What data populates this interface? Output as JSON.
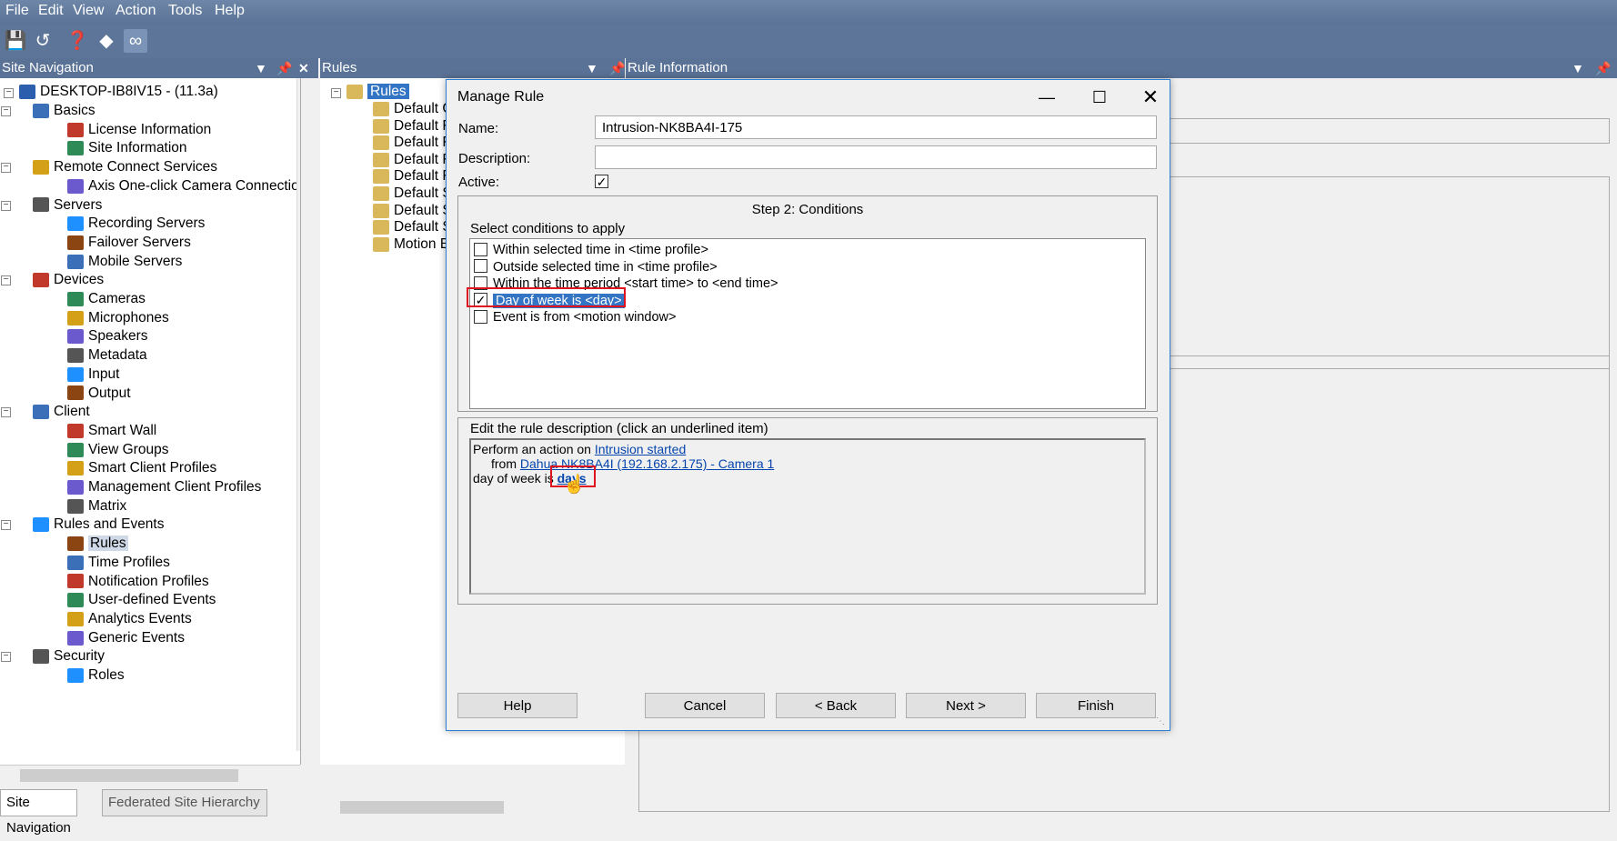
{
  "menu": [
    "File",
    "Edit",
    "View",
    "Action",
    "Tools",
    "Help"
  ],
  "toolbar": {
    "icons": [
      "save-icon",
      "undo-icon",
      "help-icon",
      "wizard-icon",
      "binoculars-icon"
    ]
  },
  "site_nav": {
    "header": "Site Navigation",
    "root": "DESKTOP-IB8IV15 - (11.3a)",
    "nodes": [
      {
        "label": "Basics",
        "level": 1
      },
      {
        "label": "License Information",
        "level": 2
      },
      {
        "label": "Site Information",
        "level": 2
      },
      {
        "label": "Remote Connect Services",
        "level": 1
      },
      {
        "label": "Axis One-click Camera Connectio",
        "level": 2
      },
      {
        "label": "Servers",
        "level": 1
      },
      {
        "label": "Recording Servers",
        "level": 2
      },
      {
        "label": "Failover Servers",
        "level": 2
      },
      {
        "label": "Mobile Servers",
        "level": 2
      },
      {
        "label": "Devices",
        "level": 1
      },
      {
        "label": "Cameras",
        "level": 2
      },
      {
        "label": "Microphones",
        "level": 2
      },
      {
        "label": "Speakers",
        "level": 2
      },
      {
        "label": "Metadata",
        "level": 2
      },
      {
        "label": "Input",
        "level": 2
      },
      {
        "label": "Output",
        "level": 2
      },
      {
        "label": "Client",
        "level": 1
      },
      {
        "label": "Smart Wall",
        "level": 2
      },
      {
        "label": "View Groups",
        "level": 2
      },
      {
        "label": "Smart Client Profiles",
        "level": 2
      },
      {
        "label": "Management Client Profiles",
        "level": 2
      },
      {
        "label": "Matrix",
        "level": 2
      },
      {
        "label": "Rules and Events",
        "level": 1
      },
      {
        "label": "Rules",
        "level": 2,
        "selected": true
      },
      {
        "label": "Time Profiles",
        "level": 2
      },
      {
        "label": "Notification Profiles",
        "level": 2
      },
      {
        "label": "User-defined Events",
        "level": 2
      },
      {
        "label": "Analytics Events",
        "level": 2
      },
      {
        "label": "Generic Events",
        "level": 2
      },
      {
        "label": "Security",
        "level": 1
      },
      {
        "label": "Roles",
        "level": 2
      }
    ],
    "tabs": [
      "Site Navigation",
      "Federated Site Hierarchy"
    ]
  },
  "rules_pane": {
    "header": "Rules",
    "root": "Rules",
    "items": [
      "Default G",
      "Default F",
      "Default F",
      "Default F",
      "Default F",
      "Default S",
      "Default S",
      "Default S",
      "Motion E"
    ]
  },
  "info_pane": {
    "header": "Rule Information"
  },
  "dialog": {
    "title": "Manage Rule",
    "name_label": "Name:",
    "name_value": "Intrusion-NK8BA4I-175",
    "description_label": "Description:",
    "description_value": "",
    "active_label": "Active:",
    "active_checked": true,
    "step_title": "Step 2: Conditions",
    "select_label": "Select conditions to apply",
    "conditions": [
      {
        "label": "Within selected time in <time profile>",
        "checked": false
      },
      {
        "label": "Outside selected time in <time profile>",
        "checked": false
      },
      {
        "label": "Within the time period <start time> to <end time>",
        "checked": false
      },
      {
        "label": "Day of week is <day>",
        "checked": true,
        "selected": true
      },
      {
        "label": "Event is from <motion window>",
        "checked": false
      }
    ],
    "edit_label": "Edit the rule description (click an underlined item)",
    "desc_line1_prefix": "Perform an action on ",
    "desc_line1_link": "Intrusion started",
    "desc_line2_prefix": "from ",
    "desc_line2_link": "Dahua NK8BA4I (192.168.2.175) - Camera 1",
    "desc_line3_prefix": "day of week is ",
    "desc_line3_link": "days",
    "buttons": {
      "help": "Help",
      "cancel": "Cancel",
      "back": "< Back",
      "next": "Next >",
      "finish": "Finish"
    }
  }
}
